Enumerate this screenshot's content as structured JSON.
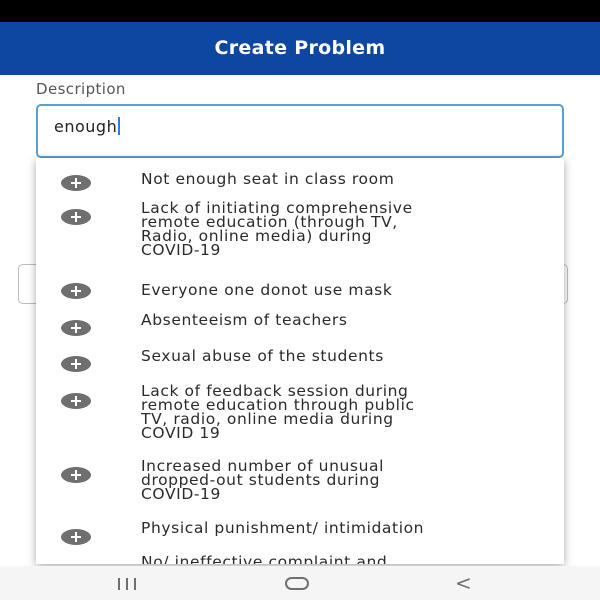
{
  "header": {
    "title": "Create Problem"
  },
  "form": {
    "description_label": "Description",
    "description_value": "enough"
  },
  "suggestions": [
    {
      "lines": [
        "Not enough seat in class room"
      ]
    },
    {
      "lines": [
        "Lack of initiating comprehensive",
        "remote education (through TV,",
        "Radio, online media) during",
        "COVID-19"
      ]
    },
    {
      "lines": [
        "Everyone one donot use mask"
      ]
    },
    {
      "lines": [
        "Absenteeism of teachers"
      ]
    },
    {
      "lines": [
        "Sexual abuse of the students"
      ]
    },
    {
      "lines": [
        "Lack of feedback session during",
        "remote education through public",
        "TV, radio, online media during",
        "COVID 19"
      ]
    },
    {
      "lines": [
        "Increased number of unusual",
        "dropped-out students during",
        "COVID-19"
      ]
    },
    {
      "lines": [
        "Physical punishment/ intimidation"
      ]
    },
    {
      "lines": [
        "No/ ineffective complaint and"
      ]
    }
  ],
  "icons": {
    "suggestion_add": "plus-circle-icon",
    "nav_recent": "recent-apps-icon",
    "nav_home": "home-icon",
    "nav_back": "back-icon"
  },
  "nav": {
    "back_glyph": "<"
  },
  "colors": {
    "header_bg": "#0d47a1",
    "field_border": "#5a9fd6",
    "icon_gray": "#6f6f6f"
  }
}
